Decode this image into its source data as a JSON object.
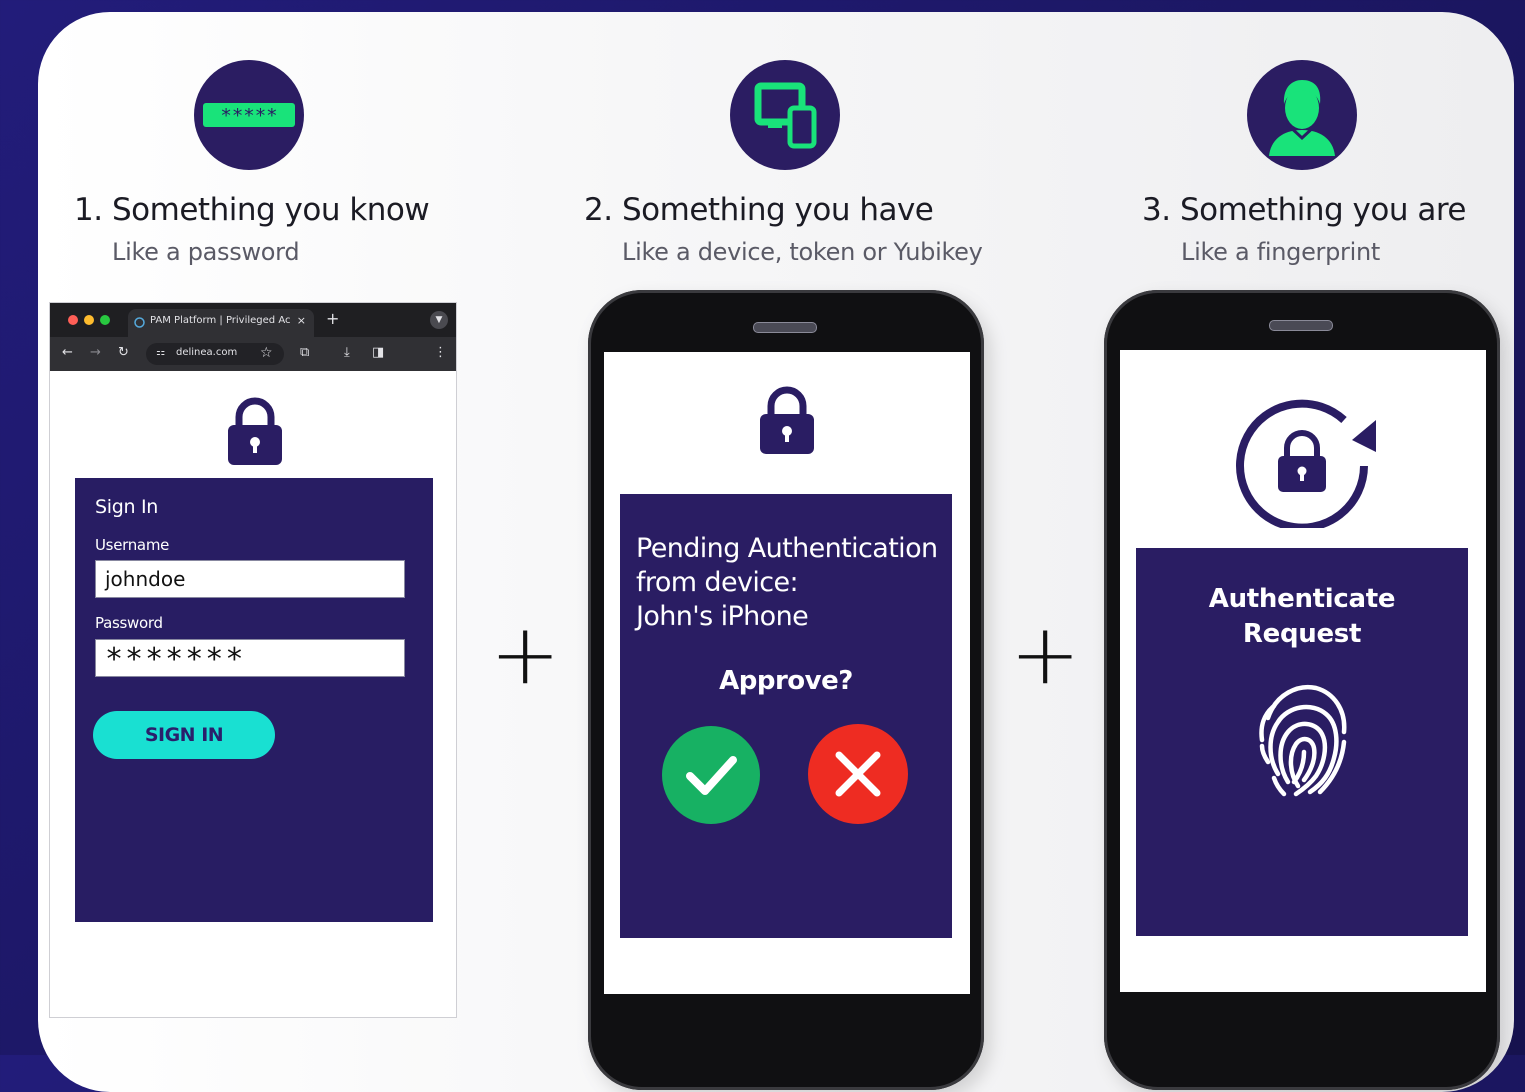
{
  "steps": [
    {
      "number": "1.",
      "title": "Something you know",
      "subtitle": "Like a password",
      "icon": "password-field-icon"
    },
    {
      "number": "2.",
      "title": "Something you have",
      "subtitle": "Like a device, token or Yubikey",
      "icon": "devices-icon"
    },
    {
      "number": "3.",
      "title": "Something you are",
      "subtitle": "Like a fingerprint",
      "icon": "user-icon"
    }
  ],
  "plus_sign": "+",
  "password_icon_text": "*****",
  "browser": {
    "tab_title": "PAM Platform | Privileged Acc",
    "tab_close": "×",
    "new_tab": "+",
    "url": "delinea.com"
  },
  "signin": {
    "title": "Sign In",
    "username_label": "Username",
    "username_value": "johndoe",
    "password_label": "Password",
    "password_value": "*******",
    "button_label": "SIGN IN"
  },
  "device_phone": {
    "line1": "Pending Authentication",
    "line2": "from device:",
    "line3": "John's iPhone",
    "question": "Approve?"
  },
  "fingerprint_phone": {
    "line1": "Authenticate",
    "line2": "Request"
  },
  "colors": {
    "background": "#1c176a",
    "navy": "#2a1d63",
    "accent_green": "#19e37a",
    "cyan": "#19e0d2",
    "approve_green": "#17b163",
    "reject_red": "#ee2c22"
  }
}
